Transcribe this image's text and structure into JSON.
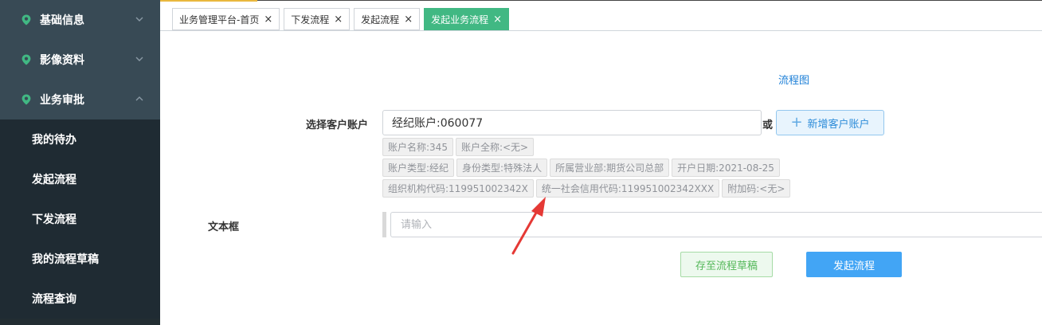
{
  "sidebar": {
    "groups": [
      {
        "label": "基础信息"
      },
      {
        "label": "影像资料"
      },
      {
        "label": "业务审批"
      }
    ],
    "items": [
      {
        "label": "我的待办"
      },
      {
        "label": "发起流程"
      },
      {
        "label": "下发流程"
      },
      {
        "label": "我的流程草稿"
      },
      {
        "label": "流程查询"
      }
    ]
  },
  "tabs": [
    {
      "label": "业务管理平台-首页",
      "close": "×"
    },
    {
      "label": "下发流程",
      "close": "×"
    },
    {
      "label": "发起流程",
      "close": "×"
    },
    {
      "label": "发起业务流程",
      "close": "×"
    }
  ],
  "colors": {
    "active_tab": "#41b883",
    "primary": "#42a5f5",
    "sidebar_bg": "#222d32",
    "sidebar_group_bg": "#384a55",
    "pin_icon": "#41b883",
    "arrow": "#e53935"
  },
  "main": {
    "flow_chart_link": "流程图",
    "account_label": "选择客户账户",
    "account_value": "经纪账户:060077",
    "or_text": "或",
    "add_account_button": "新增客户账户",
    "info_rows": [
      [
        "账户名称:345",
        "账户全称:<无>"
      ],
      [
        "账户类型:经纪",
        "身份类型:特殊法人",
        "所属营业部:期货公司总部",
        "开户日期:2021-08-25"
      ],
      [
        "组织机构代码:119951002342X",
        "统一社会信用代码:119951002342XXX",
        "附加码:<无>"
      ]
    ],
    "text_label": "文本框",
    "text_placeholder": "请输入",
    "save_draft_button": "存至流程草稿",
    "submit_button": "发起流程"
  }
}
